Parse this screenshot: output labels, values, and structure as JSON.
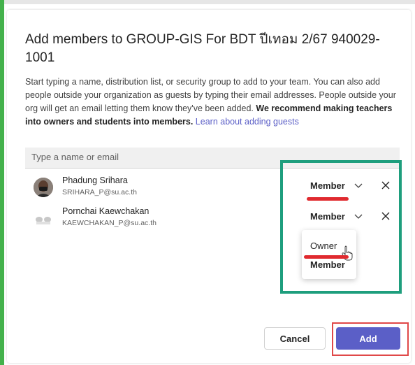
{
  "dialog": {
    "title": "Add members to GROUP-GIS For BDT ปีเทอม 2/67 940029-1001",
    "description_plain": "Start typing a name, distribution list, or security group to add to your team. You can also add people outside your organization as guests by typing their email addresses. People outside your org will get an email letting them know they've been added.",
    "description_bold": "We recommend making teachers into owners and students into members.",
    "learn_more_link": "Learn about adding guests"
  },
  "search": {
    "placeholder": "Type a name or email"
  },
  "members": [
    {
      "name": "Phadung Srihara",
      "email": "SRIHARA_P@su.ac.th",
      "role": "Member"
    },
    {
      "name": "Pornchai Kaewchakan",
      "email": "KAEWCHAKAN_P@su.ac.th",
      "role": "Member"
    }
  ],
  "role_menu": {
    "options": [
      "Owner",
      "Member"
    ],
    "selected": "Member",
    "hovered": "Owner"
  },
  "buttons": {
    "cancel": "Cancel",
    "add": "Add"
  },
  "icons": {
    "chevron": "chevron-down-icon",
    "remove": "close-icon",
    "cursor": "mouse-pointer-icon"
  },
  "colors": {
    "accent": "#5b5fc7",
    "annotation_green": "#1e9e7d",
    "annotation_red": "#e02a2f",
    "teams_edge_green": "#43b14b"
  }
}
